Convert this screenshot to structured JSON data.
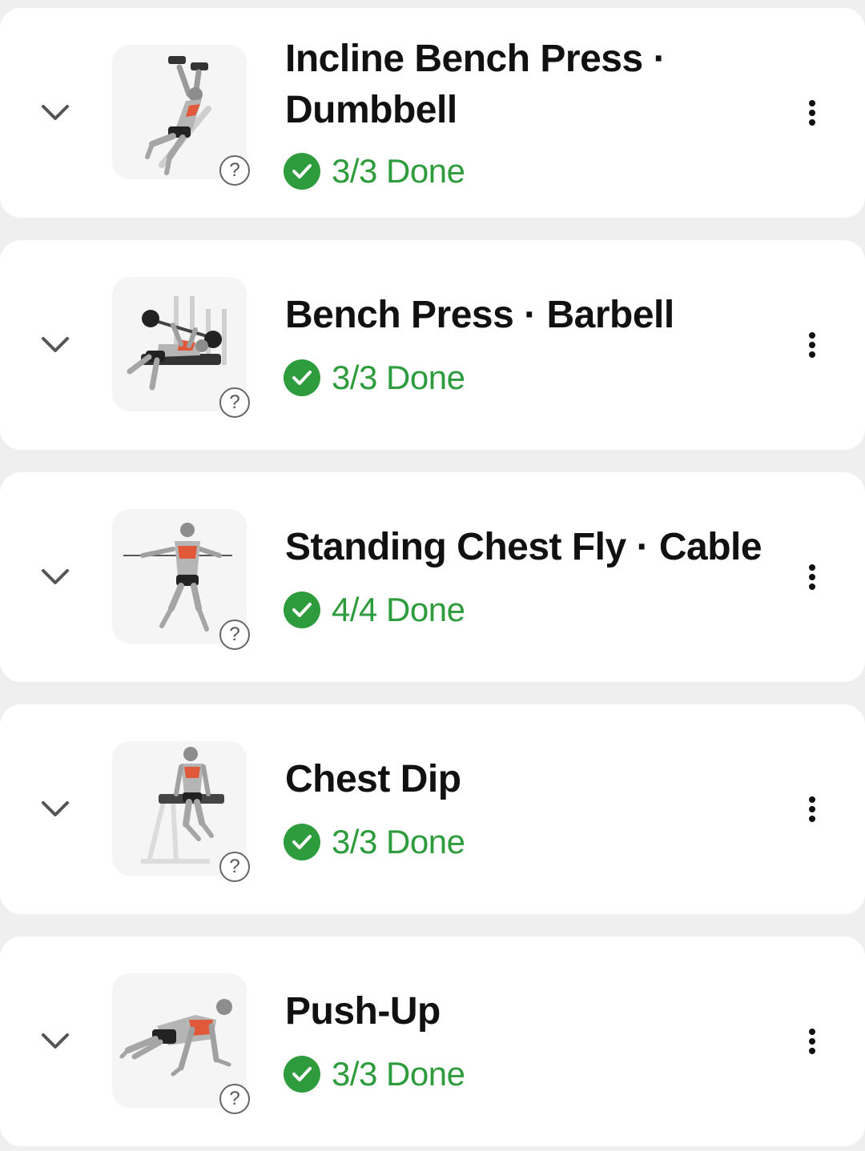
{
  "exercises": [
    {
      "title_line1": "Incline Bench Press ·",
      "title_line2": "Dumbbell",
      "status": "3/3 Done",
      "thumbnail": "incline-bench-press-dumbbell-illustration"
    },
    {
      "title_line1": "Bench Press · Barbell",
      "status": "3/3 Done",
      "thumbnail": "bench-press-barbell-illustration"
    },
    {
      "title_line1": "Standing Chest Fly · Cable",
      "status": "4/4 Done",
      "thumbnail": "standing-chest-fly-cable-illustration"
    },
    {
      "title_line1": "Chest Dip",
      "status": "3/3 Done",
      "thumbnail": "chest-dip-illustration"
    },
    {
      "title_line1": "Push-Up",
      "status": "3/3 Done",
      "thumbnail": "push-up-illustration"
    }
  ],
  "help_glyph": "?",
  "colors": {
    "done_green": "#2e9b3c",
    "muscle_highlight": "#e05a3a",
    "card_bg": "#ffffff",
    "page_bg": "#efefef"
  }
}
